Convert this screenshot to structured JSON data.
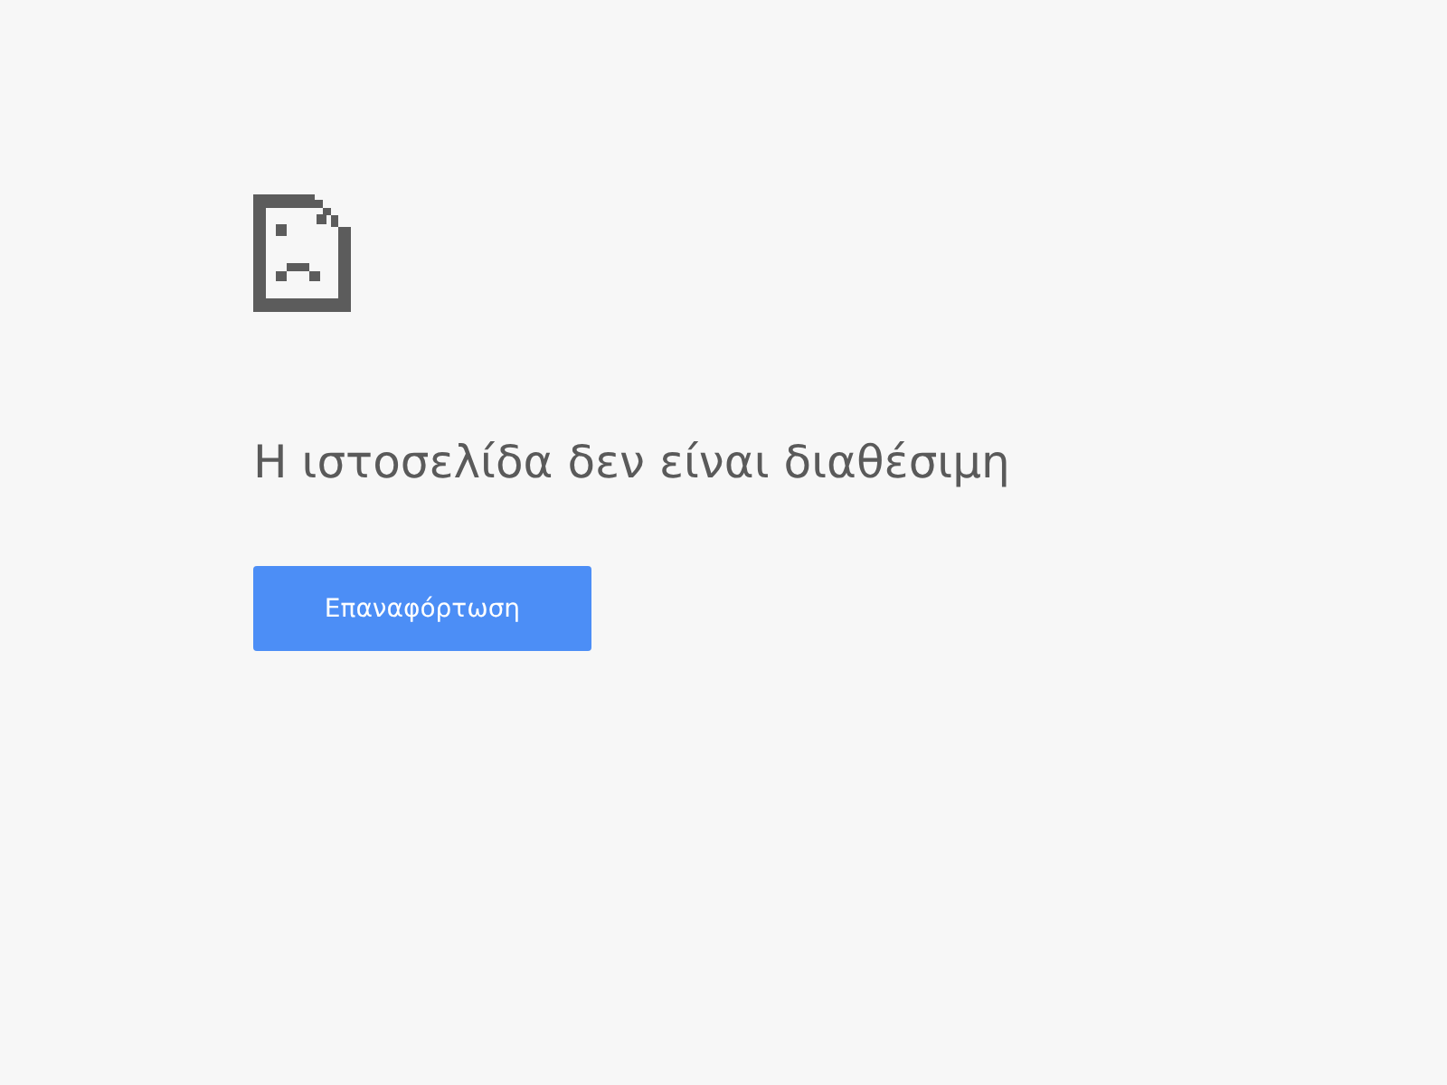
{
  "heading": "Η ιστοσελίδα δεν είναι διαθέσιμη",
  "buttons": [
    {
      "label": "Επαναφόρτωση",
      "kind": "primary"
    }
  ]
}
